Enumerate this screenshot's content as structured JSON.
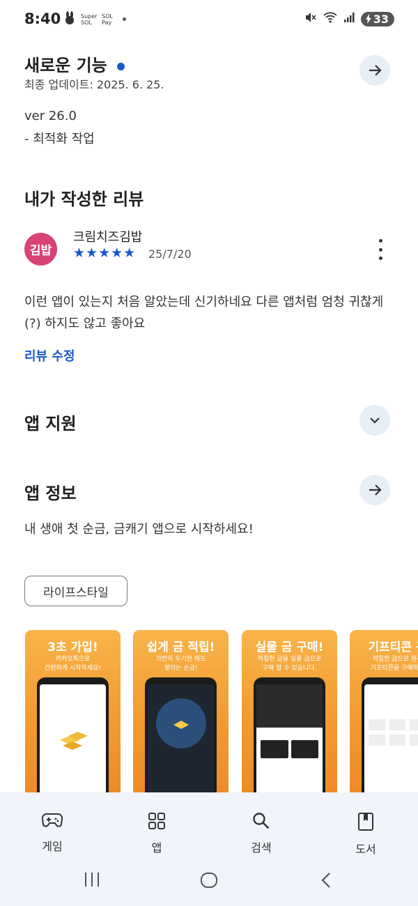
{
  "status": {
    "time": "8:40",
    "apps": [
      "Super SOL",
      "SOL Pay"
    ],
    "battery": "33"
  },
  "whats_new": {
    "title": "새로운 기능",
    "updated": "최종 업데이트: 2025. 6. 25.",
    "version": "ver 26.0",
    "note": "- 최적화 작업"
  },
  "my_review": {
    "title": "내가 작성한 리뷰",
    "avatar_text": "김밥",
    "reviewer": "크림치즈김밥",
    "stars": "★★★★★",
    "date": "25/7/20",
    "text": "이런 앱이 있는지 처음 알았는데 신기하네요 다른 앱처럼 엄청 귀찮게(?) 하지도 않고 좋아요",
    "edit_label": "리뷰 수정"
  },
  "app_support": {
    "title": "앱 지원"
  },
  "app_info": {
    "title": "앱 정보",
    "description": "내 생애 첫 순금, 금캐기 앱으로 시작하세요!",
    "category_chip": "라이프스타일"
  },
  "screenshots": [
    {
      "headline": "3초 가입!",
      "sub": "카카오톡으로\n간편하게 시작하세요!"
    },
    {
      "headline": "쉽게 금 적립!",
      "sub": "가만히 두기만 해도\n쌓이는 순금!"
    },
    {
      "headline": "실물 금 구매!",
      "sub": "적립한 금을 실물 금으로\n구매 할 수 있습니다."
    },
    {
      "headline": "기프티콘 구",
      "sub": "적립한 금으로 원하\n기프티콘을 구매하세"
    }
  ],
  "bottom_nav": [
    {
      "label": "게임",
      "icon": "gamepad-icon"
    },
    {
      "label": "앱",
      "icon": "apps-grid-icon"
    },
    {
      "label": "검색",
      "icon": "search-icon"
    },
    {
      "label": "도서",
      "icon": "book-icon"
    }
  ],
  "colors": {
    "accent_blue": "#1a57c9",
    "avatar": "#d84374",
    "nav_bg": "#f1f4fa",
    "shot_orange": "#f29a2e"
  }
}
